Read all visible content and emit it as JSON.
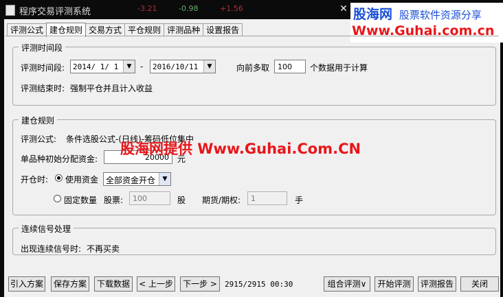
{
  "window": {
    "title": "程序交易评测系统",
    "ghost_numbers": [
      "-3.21",
      "-0.98",
      "+1.56"
    ]
  },
  "brand": {
    "name": "股海网",
    "slogan": "股票软件资源分享",
    "url": "Www.Guhai.com.cn"
  },
  "tabs": [
    {
      "label": "评测公式"
    },
    {
      "label": "建仓规则"
    },
    {
      "label": "交易方式"
    },
    {
      "label": "平仓规则"
    },
    {
      "label": "评测品种"
    },
    {
      "label": "设置报告"
    }
  ],
  "period": {
    "legend": "评测时间段",
    "label": "评测时间段:",
    "start": "2014/ 1/ 1",
    "dash": "-",
    "end": "2016/10/11",
    "lookback_label": "向前多取",
    "lookback_value": "100",
    "lookback_suffix": "个数据用于计算",
    "end_label": "评测结束时:",
    "end_value": "强制平仓并且计入收益"
  },
  "rules": {
    "legend": "建仓规则",
    "formula_label": "评测公式:",
    "formula_value": "条件选股公式-(日线)-筹码低位集中",
    "capital_label": "单品种初始分配资金:",
    "capital_value": "20000",
    "capital_unit": "元",
    "open_label": "开仓时:",
    "use_capital_label": "使用资金",
    "use_capital_selected": true,
    "capital_mode": "全部资金开仓",
    "fixed_qty_label": "固定数量",
    "fixed_qty_selected": false,
    "stock_label": "股票:",
    "stock_value": "100",
    "stock_unit": "股",
    "futures_label": "期货/期权:",
    "futures_value": "1",
    "futures_unit": "手"
  },
  "signal": {
    "legend": "连续信号处理",
    "label": "出现连续信号时:",
    "value": "不再买卖"
  },
  "watermark": "股海网提供 Www.Guhai.Com.CN",
  "buttons": {
    "import": "引入方案",
    "save": "保存方案",
    "download": "下载数据",
    "prev": "< 上一步",
    "next": "下一步 >",
    "combo": "组合评测∨",
    "start": "开始评测",
    "report": "评测报告",
    "close": "关闭"
  },
  "status": "2915/2915 00:30",
  "colors": {
    "titlebar": "#0b0b0b",
    "brand_blue": "#1a4fd6",
    "brand_red": "#e8161a",
    "dialog_bg": "#f0f0f0"
  }
}
